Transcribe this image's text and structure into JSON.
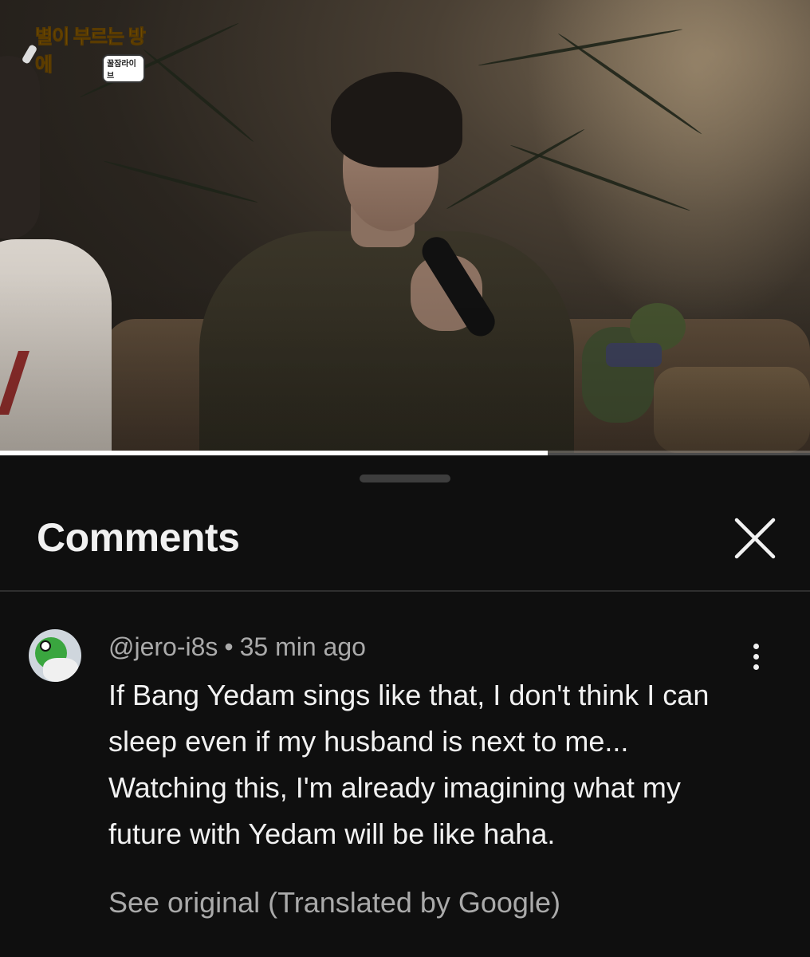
{
  "video": {
    "logo_text": "별이 부르는 방에",
    "logo_badge": "꿀잠라이브",
    "progress": 0.676
  },
  "sheet": {
    "title": "Comments",
    "close_icon": "close-icon"
  },
  "comment": {
    "author": "@jero-i8s",
    "separator": "•",
    "time": "35 min ago",
    "text": "If Bang Yedam sings like that, I don't think I can sleep even if my husband is next to me... Watching this, I'm already imagining what my future with Yedam will be like haha.",
    "see_original": "See original (Translated by Google)",
    "menu_icon": "more-vertical-icon"
  }
}
